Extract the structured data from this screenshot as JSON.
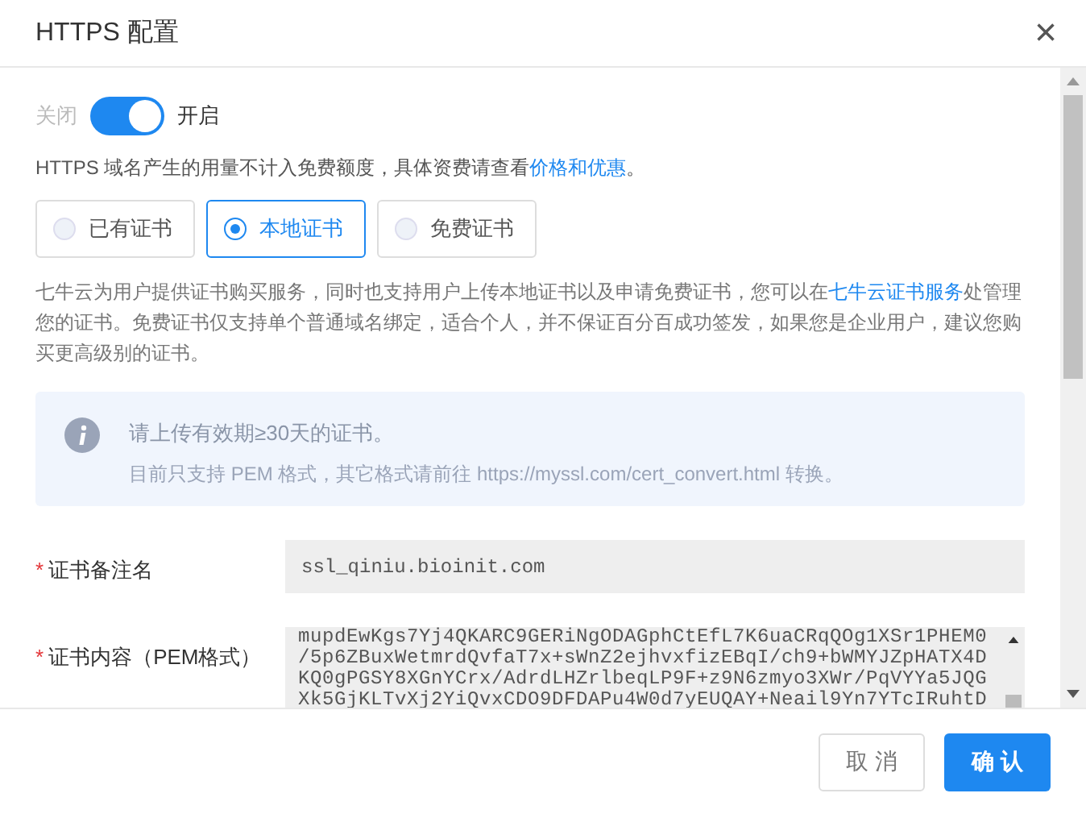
{
  "dialog": {
    "title": "HTTPS 配置",
    "close": "×"
  },
  "toggle": {
    "off_label": "关闭",
    "on_label": "开启",
    "on": true
  },
  "notice": {
    "text": "HTTPS 域名产生的用量不计入免费额度，具体资费请查看",
    "link": "价格和优惠",
    "suffix": "。"
  },
  "cert_types": [
    {
      "label": "已有证书",
      "selected": false
    },
    {
      "label": "本地证书",
      "selected": true
    },
    {
      "label": "免费证书",
      "selected": false
    }
  ],
  "description": {
    "text": "七牛云为用户提供证书购买服务，同时也支持用户上传本地证书以及申请免费证书，您可以在",
    "link": "七牛云证书服务",
    "rest": "处管理您的证书。免费证书仅支持单个普通域名绑定，适合个人，并不保证百分百成功签发，如果您是企业用户，建议您购买更高级别的证书。"
  },
  "info": {
    "title": "请上传有效期≥30天的证书。",
    "detail": "目前只支持 PEM 格式，其它格式请前往 https://myssl.com/cert_convert.html 转换。"
  },
  "fields": [
    {
      "label": "证书备注名",
      "required": true,
      "mark": "*",
      "value": "ssl_qiniu.bioinit.com"
    },
    {
      "label": "证书内容（PEM格式）",
      "required": true,
      "mark": "*",
      "lines": [
        "mupdEwKgs7Yj4QKARC9GERiNgODAGphCtEfL7K6uaCRqQOg1XSr1PHEM0",
        "/5p6ZBuxWetmrdQvfaT7x+sWnZ2ejhvxfizEBqI/ch9+bWMYJZpHATX4D",
        "KQ0gPGSY8XGnYCrx/AdrdLHZrlbeqLP9F+z9N6zmyo3XWr/PqVYYa5JQG",
        "Xk5GjKLTvXj2YiQvxCDO9DFDAPu4W0d7yEUQAY+Neail9Yn7YTcIRuhtD"
      ]
    }
  ],
  "buttons": [
    {
      "label": "取 消",
      "kind": "secondary"
    },
    {
      "label": "确 认",
      "kind": "primary"
    }
  ]
}
